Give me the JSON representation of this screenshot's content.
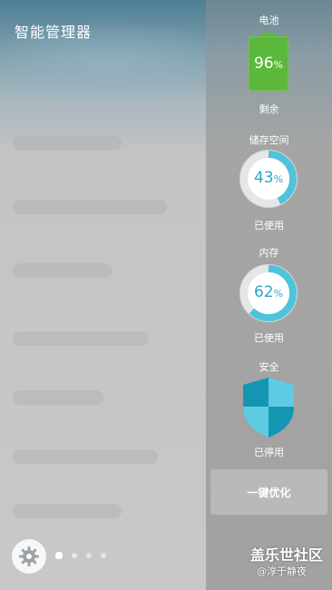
{
  "app": {
    "title": "智能管理器"
  },
  "battery": {
    "label": "电池",
    "value": 96,
    "value_text": "96",
    "unit": "%",
    "status": "剩余",
    "color": "#5cb83c"
  },
  "storage": {
    "label": "储存空间",
    "value": 43,
    "value_text": "43",
    "unit": "%",
    "status": "已使用",
    "ring_color": "#4fc3dc",
    "track_color": "#e6e6e6"
  },
  "memory": {
    "label": "内存",
    "value": 62,
    "value_text": "62",
    "unit": "%",
    "status": "已使用",
    "ring_color": "#4fc3dc",
    "track_color": "#e6e6e6"
  },
  "security": {
    "label": "安全",
    "status": "已停用",
    "icon": "shield-icon",
    "color": "#1ba7c4"
  },
  "actions": {
    "optimize_label": "一键优化"
  },
  "settings": {
    "icon": "gear-icon"
  },
  "pager": {
    "count": 4,
    "active_index": 0
  },
  "watermark": {
    "line1": "盖乐世社区",
    "line2": "@淳于静夜"
  }
}
